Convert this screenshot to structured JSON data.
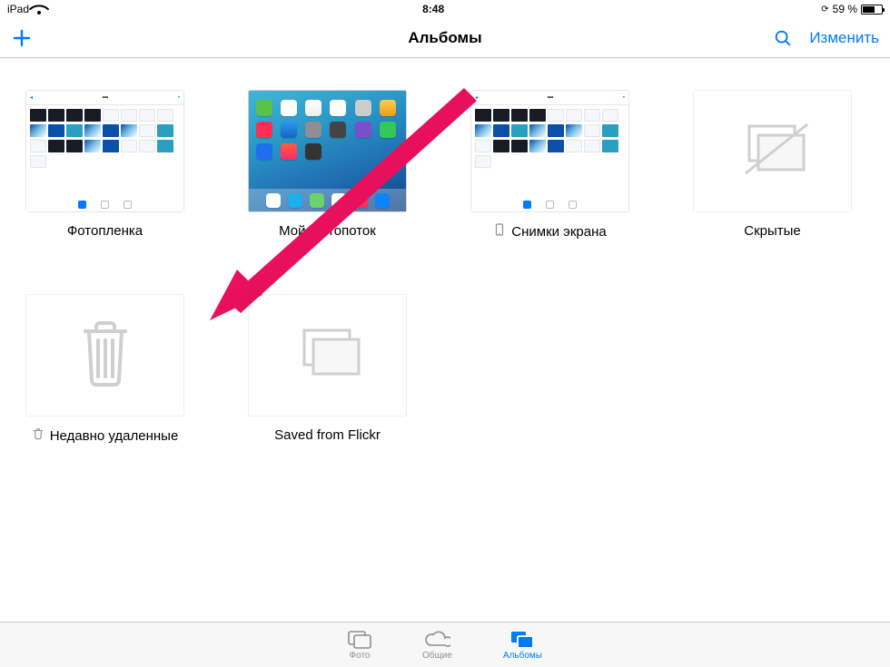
{
  "statusbar": {
    "device": "iPad",
    "time": "8:48",
    "battery_text": "59 %",
    "battery_pct": 59
  },
  "navbar": {
    "title": "Альбомы",
    "edit_label": "Изменить"
  },
  "albums": [
    {
      "id": "camera-roll",
      "title": "Фотопленка",
      "icon": null
    },
    {
      "id": "photostream",
      "title": "Мой фотопоток",
      "icon": null
    },
    {
      "id": "screenshots",
      "title": "Снимки экрана",
      "icon": "device"
    },
    {
      "id": "hidden",
      "title": "Скрытые",
      "icon": null
    },
    {
      "id": "recently-del",
      "title": "Недавно удаленные",
      "icon": "trash"
    },
    {
      "id": "saved-flickr",
      "title": "Saved from Flickr",
      "icon": null
    }
  ],
  "tabs": {
    "photos": {
      "label": "Фото",
      "active": false
    },
    "shared": {
      "label": "Общие",
      "active": false
    },
    "albums": {
      "label": "Альбомы",
      "active": true
    }
  },
  "colors": {
    "tint": "#007aff",
    "arrow": "#ec1563"
  }
}
